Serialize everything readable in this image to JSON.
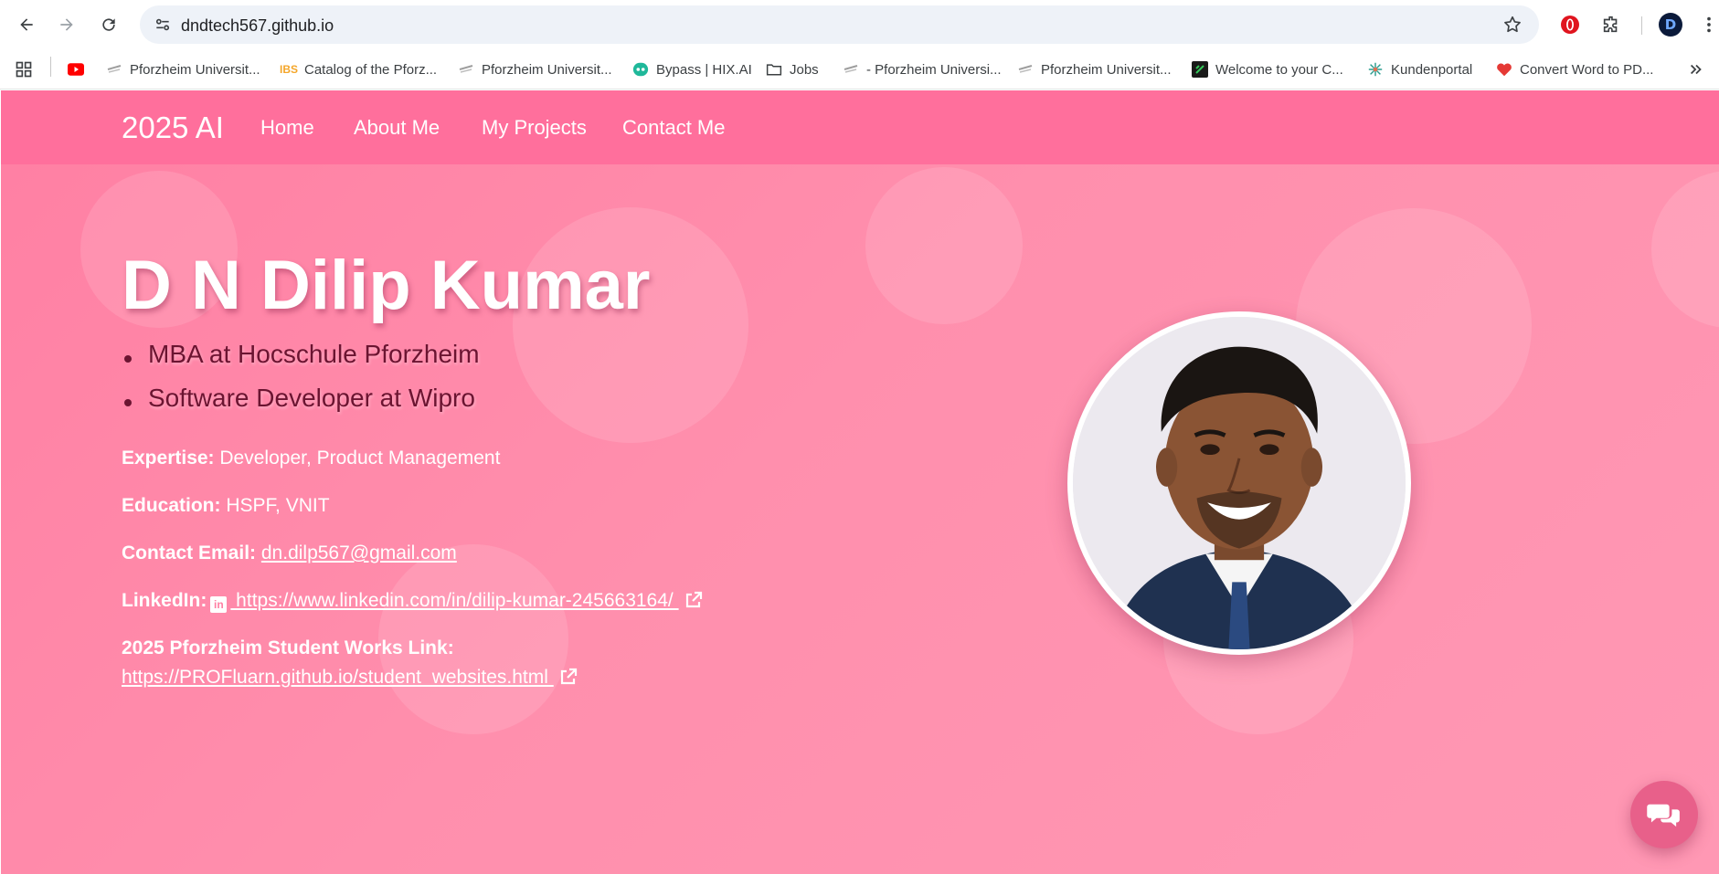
{
  "browser": {
    "url": "dndtech567.github.io",
    "profile_initial": "D"
  },
  "bookmarks": [
    {
      "label": "",
      "icon": "youtube-icon",
      "color": "#ff0000"
    },
    {
      "label": "Pforzheim Universit...",
      "icon": "hs-pforzheim-icon"
    },
    {
      "label": "Catalog of the Pforz...",
      "icon": "ibs-icon",
      "color": "#f4a62a"
    },
    {
      "label": "Pforzheim Universit...",
      "icon": "hs-pforzheim-icon"
    },
    {
      "label": "Bypass | HIX.AI",
      "icon": "hix-icon",
      "color": "#1fb89a"
    },
    {
      "label": "Jobs",
      "icon": "folder-icon"
    },
    {
      "label": "- Pforzheim Universi...",
      "icon": "hs-pforzheim-icon"
    },
    {
      "label": "Pforzheim Universit...",
      "icon": "hs-pforzheim-icon"
    },
    {
      "label": "Welcome to your C...",
      "icon": "welcome-icon",
      "color": "#1a1a1a"
    },
    {
      "label": "Kundenportal",
      "icon": "kundenportal-icon",
      "color": "#2a9d8f"
    },
    {
      "label": "Convert Word to PD...",
      "icon": "heart-icon",
      "color": "#e53935"
    }
  ],
  "site": {
    "brand": "2025 AI",
    "nav": [
      "Home",
      "About Me",
      "My Projects",
      "Contact Me"
    ],
    "name": "D N Dilip Kumar",
    "roles": [
      "MBA at Hocschule Pforzheim",
      "Software Developer at Wipro"
    ],
    "expertise_label": "Expertise:",
    "expertise_value": "Developer, Product Management",
    "education_label": "Education:",
    "education_value": "HSPF, VNIT",
    "email_label": "Contact Email:",
    "email_value": "dn.dilp567@gmail.com",
    "linkedin_label": "LinkedIn:",
    "linkedin_icon": "in",
    "linkedin_url": " https://www.linkedin.com/in/dilip-kumar-245663164/ ",
    "works_label": "2025 Pforzheim Student Works Link:",
    "works_url": "https://PROFluarn.github.io/student_websites.html "
  },
  "colors": {
    "header": "#ff6f9c",
    "background": "#ff8fad",
    "role_text": "#6b1431",
    "chat_button": "#e8608a"
  }
}
